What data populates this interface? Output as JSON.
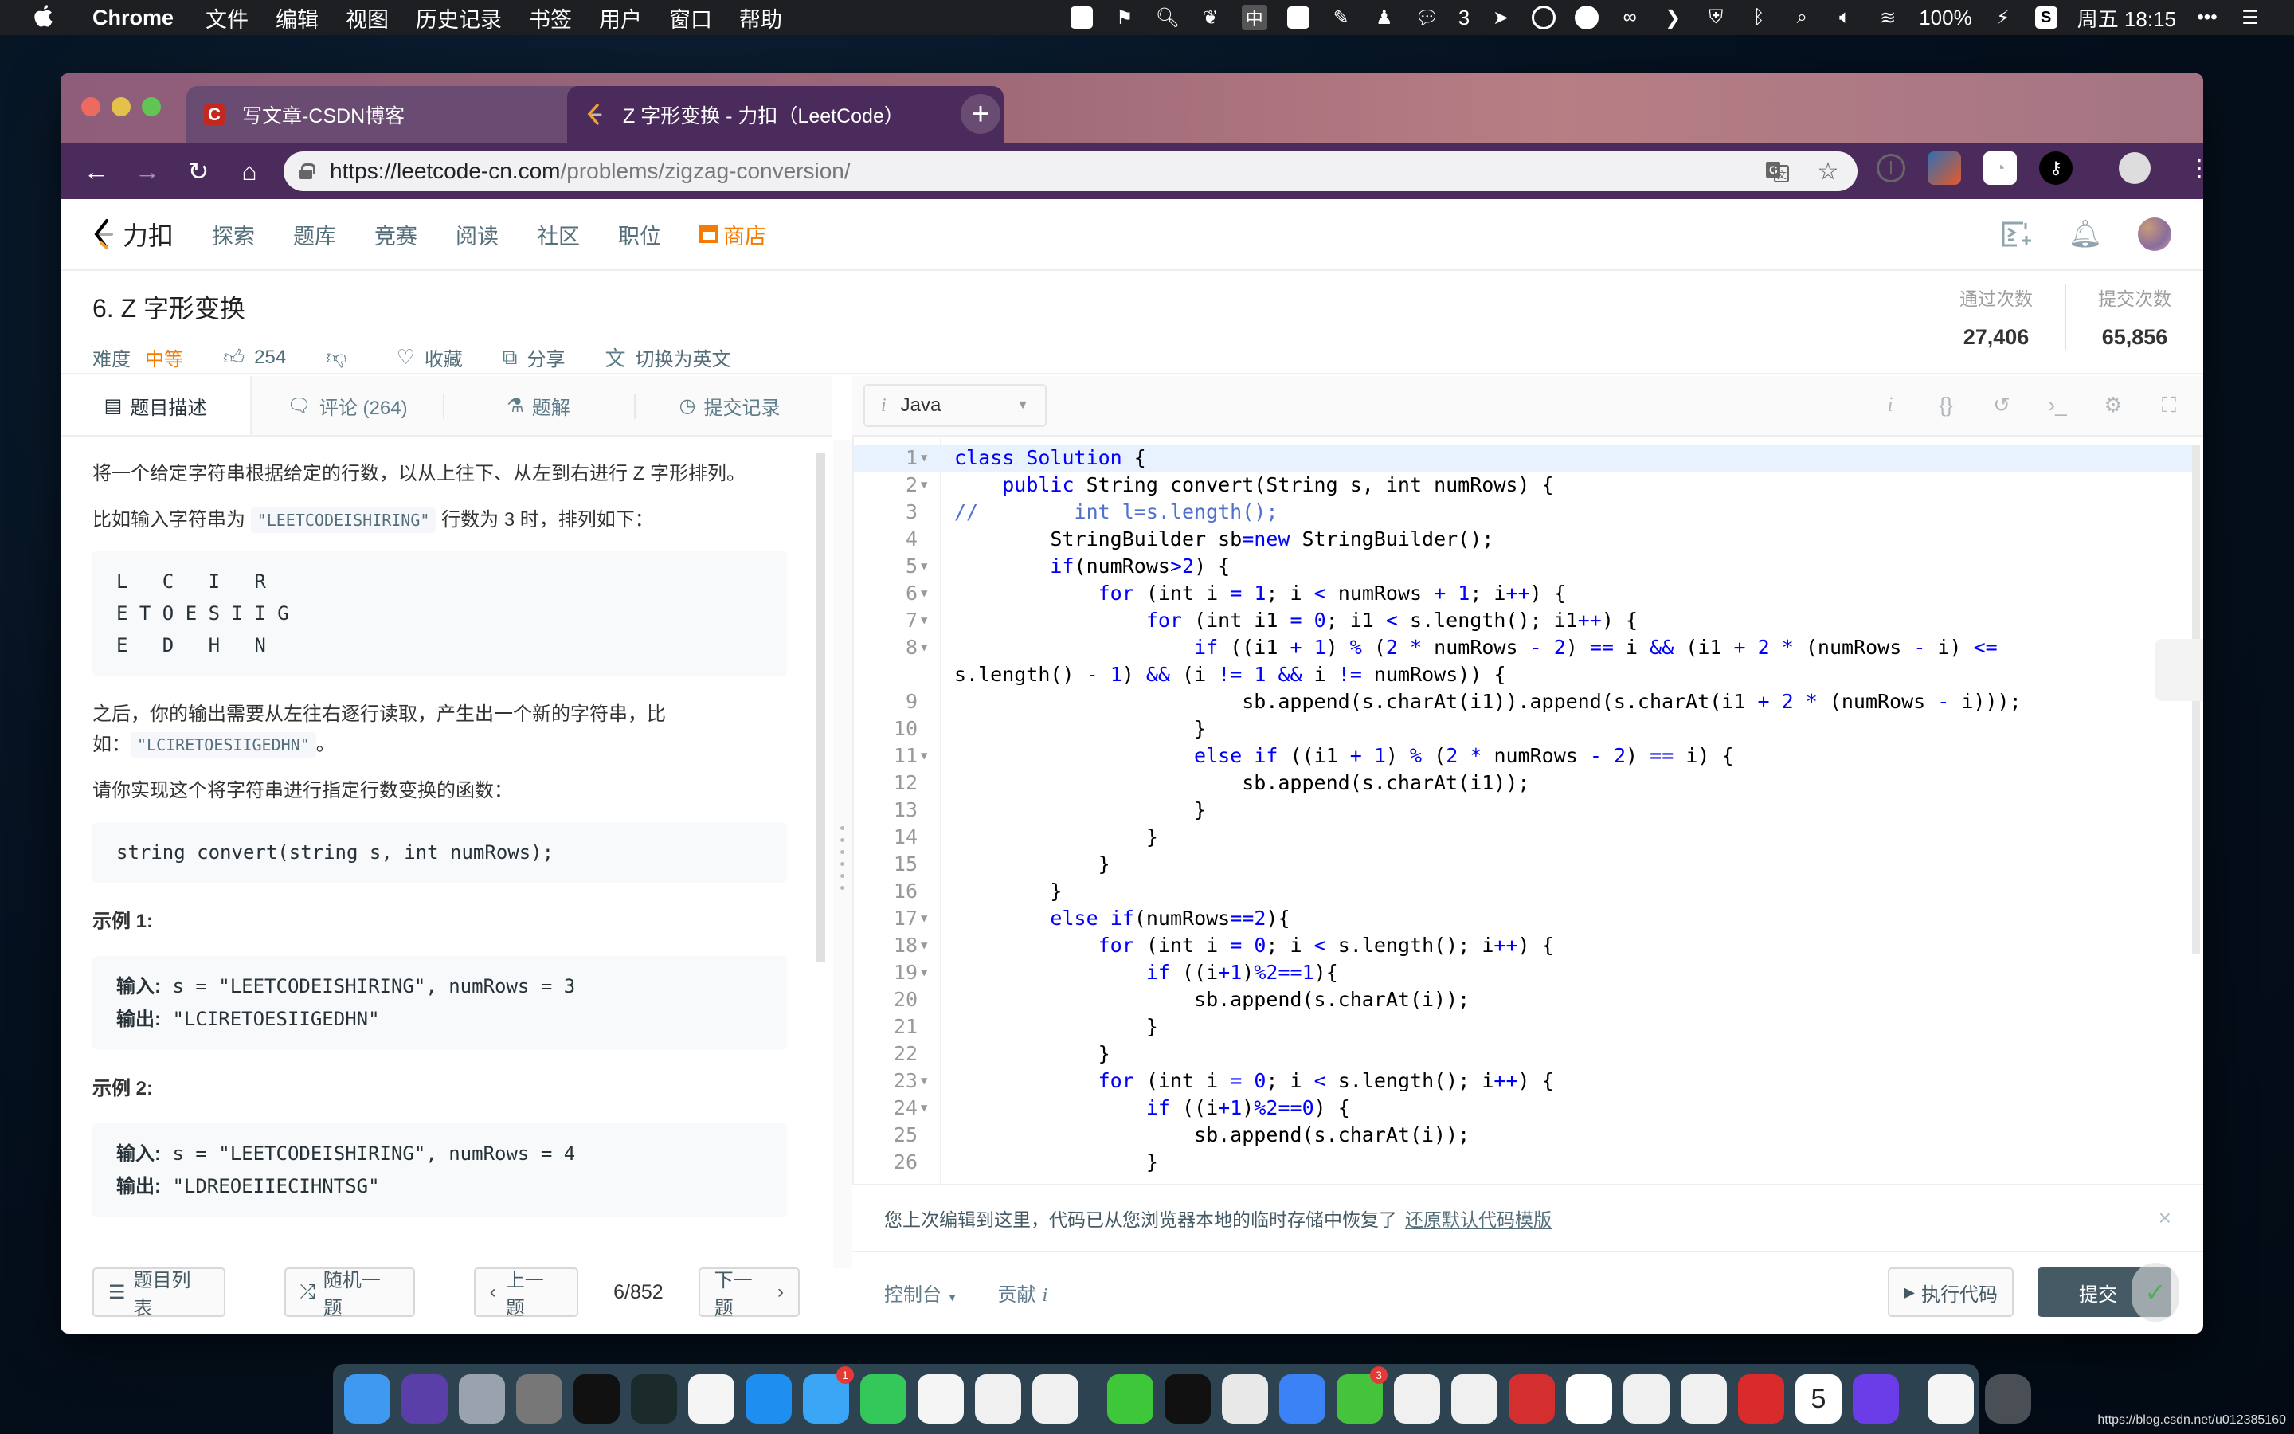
{
  "menubar": {
    "app_name": "Chrome",
    "menus": [
      "文件",
      "编辑",
      "视图",
      "历史记录",
      "书签",
      "用户",
      "窗口",
      "帮助"
    ],
    "wechat_count": "3",
    "battery": "100%",
    "clock": "周五 18:15",
    "input_method": "中"
  },
  "browser": {
    "tabs": [
      {
        "title": "写文章-CSDN博客",
        "favicon": "C",
        "active": false
      },
      {
        "title": "Z 字形变换 - 力扣（LeetCode）",
        "favicon": "leetcode",
        "active": true
      }
    ],
    "url_host": "https://leetcode-cn.com",
    "url_path": "/problems/zigzag-conversion/",
    "new_tab_label": "+",
    "close_label": "×"
  },
  "lc_nav": {
    "logo_text": "力扣",
    "links": [
      "探索",
      "题库",
      "竞赛",
      "阅读",
      "社区",
      "职位"
    ],
    "store_label": "商店"
  },
  "problem": {
    "title": "6. Z 字形变换",
    "difficulty_label": "难度",
    "difficulty": "中等",
    "likes": "254",
    "favorite_label": "收藏",
    "share_label": "分享",
    "switch_lang_label": "切换为英文",
    "accepted_label": "通过次数",
    "accepted_value": "27,406",
    "submissions_label": "提交次数",
    "submissions_value": "65,856"
  },
  "left_tabs": [
    {
      "label": "题目描述",
      "icon": "description-icon"
    },
    {
      "label": "评论 (264)",
      "icon": "comment-icon"
    },
    {
      "label": "题解",
      "icon": "flask-icon"
    },
    {
      "label": "提交记录",
      "icon": "clock-icon"
    }
  ],
  "description": {
    "p1": "将一个给定字符串根据给定的行数，以从上往下、从左到右进行 Z 字形排列。",
    "p2_before": "比如输入字符串为",
    "p2_code": "\"LEETCODEISHIRING\"",
    "p2_after": "行数为 3 时，排列如下：",
    "zigzag": "L   C   I   R\nE T O E S I I G\nE   D   H   N",
    "p3_before": "之后，你的输出需要从左往右逐行读取，产生出一个新的字符串，比如：",
    "p3_code": "\"LCIRETOESIIGEDHN\"",
    "p3_after": "。",
    "p4": "请你实现这个将字符串进行指定行数变换的函数：",
    "signature": "string convert(string s, int numRows);",
    "example1_title": "示例 1:",
    "example1_input_label": "输入:",
    "example1_input": " s = \"LEETCODEISHIRING\", numRows = 3",
    "example1_output_label": "输出:",
    "example1_output": " \"LCIRETOESIIGEDHN\"",
    "example2_title": "示例 2:",
    "example2_input_label": "输入:",
    "example2_input": " s = \"LEETCODEISHIRING\", numRows = 4",
    "example2_output_label": "输出:",
    "example2_output": " \"LDREOEIIECIHNTSG\""
  },
  "left_footer": {
    "list_label": "题目列表",
    "random_label": "随机一题",
    "prev_label": "上一题",
    "counter": "6/852",
    "next_label": "下一题"
  },
  "editor": {
    "language": "Java",
    "code_lines": [
      {
        "n": "1",
        "fold": true,
        "html": "<span class=\"kw\">class</span> <span class=\"kw\">Solution</span> {"
      },
      {
        "n": "2",
        "fold": true,
        "html": "    <span class=\"kw\">public</span> String convert(String s, int numRows) {"
      },
      {
        "n": "3",
        "fold": false,
        "html": "<span class=\"cm\">//        int l=s.length();</span>"
      },
      {
        "n": "4",
        "fold": false,
        "html": "        StringBuilder sb<span class=\"op\">=</span><span class=\"kw\">new</span> StringBuilder();"
      },
      {
        "n": "5",
        "fold": true,
        "html": "        <span class=\"kw\">if</span>(numRows<span class=\"op\">&gt;</span><span class=\"num\">2</span>) {"
      },
      {
        "n": "6",
        "fold": true,
        "html": "            <span class=\"kw\">for</span> (int i <span class=\"op\">=</span> <span class=\"num\">1</span>; i <span class=\"op\">&lt;</span> numRows <span class=\"op\">+</span> <span class=\"num\">1</span>; i<span class=\"op\">++</span>) {"
      },
      {
        "n": "7",
        "fold": true,
        "html": "                <span class=\"kw\">for</span> (int i1 <span class=\"op\">=</span> <span class=\"num\">0</span>; i1 <span class=\"op\">&lt;</span> s.length(); i1<span class=\"op\">++</span>) {"
      },
      {
        "n": "8",
        "fold": true,
        "html": "                    <span class=\"kw\">if</span> ((i1 <span class=\"op\">+</span> <span class=\"num\">1</span>) <span class=\"op\">%</span> (<span class=\"num\">2</span> <span class=\"op\">*</span> numRows <span class=\"op\">-</span> <span class=\"num\">2</span>) <span class=\"op\">==</span> i <span class=\"op\">&amp;&amp;</span> (i1 <span class=\"op\">+</span> <span class=\"num\">2</span> <span class=\"op\">*</span> (numRows <span class=\"op\">-</span> i) <span class=\"op\">&lt;=</span>"
      },
      {
        "n": "",
        "fold": false,
        "wrap": true,
        "html": "s.length() <span class=\"op\">-</span> <span class=\"num\">1</span>) <span class=\"op\">&amp;&amp;</span> (i <span class=\"op\">!=</span> <span class=\"num\">1</span> <span class=\"op\">&amp;&amp;</span> i <span class=\"op\">!=</span> numRows)) {"
      },
      {
        "n": "9",
        "fold": false,
        "html": "                        sb.append(s.charAt(i1)).append(s.charAt(i1 <span class=\"op\">+</span> <span class=\"num\">2</span> <span class=\"op\">*</span> (numRows <span class=\"op\">-</span> i)));"
      },
      {
        "n": "10",
        "fold": false,
        "html": "                    }"
      },
      {
        "n": "11",
        "fold": true,
        "html": "                    <span class=\"kw\">else</span> <span class=\"kw\">if</span> ((i1 <span class=\"op\">+</span> <span class=\"num\">1</span>) <span class=\"op\">%</span> (<span class=\"num\">2</span> <span class=\"op\">*</span> numRows <span class=\"op\">-</span> <span class=\"num\">2</span>) <span class=\"op\">==</span> i) {"
      },
      {
        "n": "12",
        "fold": false,
        "html": "                        sb.append(s.charAt(i1));"
      },
      {
        "n": "13",
        "fold": false,
        "html": "                    }"
      },
      {
        "n": "14",
        "fold": false,
        "html": "                }"
      },
      {
        "n": "15",
        "fold": false,
        "html": "            }"
      },
      {
        "n": "16",
        "fold": false,
        "html": "        }"
      },
      {
        "n": "17",
        "fold": true,
        "html": "        <span class=\"kw\">else</span> <span class=\"kw\">if</span>(numRows<span class=\"op\">==</span><span class=\"num\">2</span>){"
      },
      {
        "n": "18",
        "fold": true,
        "html": "            <span class=\"kw\">for</span> (int i <span class=\"op\">=</span> <span class=\"num\">0</span>; i <span class=\"op\">&lt;</span> s.length(); i<span class=\"op\">++</span>) {"
      },
      {
        "n": "19",
        "fold": true,
        "html": "                <span class=\"kw\">if</span> ((i<span class=\"op\">+</span><span class=\"num\">1</span>)<span class=\"op\">%</span><span class=\"num\">2</span><span class=\"op\">==</span><span class=\"num\">1</span>){"
      },
      {
        "n": "20",
        "fold": false,
        "html": "                    sb.append(s.charAt(i));"
      },
      {
        "n": "21",
        "fold": false,
        "html": "                }"
      },
      {
        "n": "22",
        "fold": false,
        "html": "            }"
      },
      {
        "n": "23",
        "fold": true,
        "html": "            <span class=\"kw\">for</span> (int i <span class=\"op\">=</span> <span class=\"num\">0</span>; i <span class=\"op\">&lt;</span> s.length(); i<span class=\"op\">++</span>) {"
      },
      {
        "n": "24",
        "fold": true,
        "html": "                <span class=\"kw\">if</span> ((i<span class=\"op\">+</span><span class=\"num\">1</span>)<span class=\"op\">%</span><span class=\"num\">2</span><span class=\"op\">==</span><span class=\"num\">0</span>) {"
      },
      {
        "n": "25",
        "fold": false,
        "html": "                    sb.append(s.charAt(i));"
      },
      {
        "n": "26",
        "fold": false,
        "html": "                }"
      }
    ],
    "restore_message": "您上次编辑到这里，代码已从您浏览器本地的临时存储中恢复了",
    "restore_link": "还原默认代码模版"
  },
  "right_footer": {
    "console_label": "控制台",
    "contribute_label": "贡献",
    "run_label": "执行代码",
    "submit_label": "提交"
  },
  "dock": {
    "apps": [
      "finder",
      "siri",
      "launchpad",
      "system-preferences",
      "terminal",
      "activity-monitor",
      "photos",
      "app-store",
      "messages",
      "facetime",
      "music",
      "app",
      "app",
      "iqiyi",
      "qq",
      "chrome",
      "feishu",
      "wechat",
      "app",
      "speed",
      "email",
      "baidu-netdisk",
      "app",
      "1password",
      "netease-music",
      "calendar",
      "intellij"
    ],
    "messages_badge": "1",
    "wechat_badge": "3",
    "calendar_date": "5"
  },
  "watermark": "https://blog.csdn.net/u012385160"
}
